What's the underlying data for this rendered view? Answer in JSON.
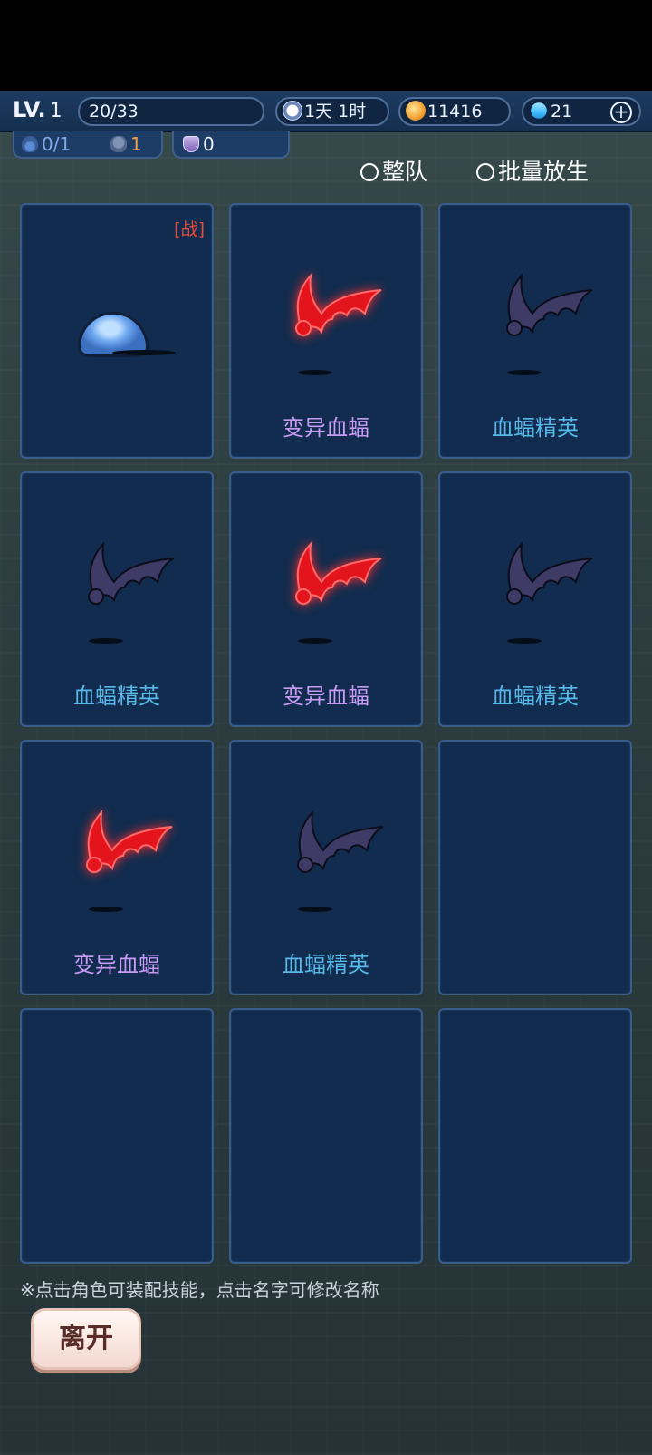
{
  "hud": {
    "level_label": "LV.",
    "level_value": "1",
    "exp": "20/33",
    "time": "1天 1时",
    "gold": "11416",
    "gems": "21",
    "stat_fire": "0/1",
    "stat_minion": "1",
    "stat_shield": "0"
  },
  "options": {
    "formation": "整队",
    "batch_release": "批量放生"
  },
  "grid": {
    "battle_tag": "[战]",
    "cards": [
      {
        "name": "",
        "type": "slime",
        "battle": true
      },
      {
        "name": "变异血蝠",
        "type": "red-bat"
      },
      {
        "name": "血蝠精英",
        "type": "dark-bat"
      },
      {
        "name": "血蝠精英",
        "type": "dark-bat"
      },
      {
        "name": "变异血蝠",
        "type": "red-bat"
      },
      {
        "name": "血蝠精英",
        "type": "dark-bat"
      },
      {
        "name": "变异血蝠",
        "type": "red-bat"
      },
      {
        "name": "血蝠精英",
        "type": "dark-bat"
      },
      {
        "name": "",
        "type": "empty"
      },
      {
        "name": "",
        "type": "empty"
      },
      {
        "name": "",
        "type": "empty"
      },
      {
        "name": "",
        "type": "empty"
      }
    ]
  },
  "footer": {
    "tip": "※点击角色可装配技能，点击名字可修改名称",
    "leave_label": "离开"
  },
  "colors": {
    "card_bg": "#112c4e",
    "mutant_name": "#c89bf5",
    "elite_name": "#58b8e8",
    "battle_tag": "#e84a3a"
  }
}
